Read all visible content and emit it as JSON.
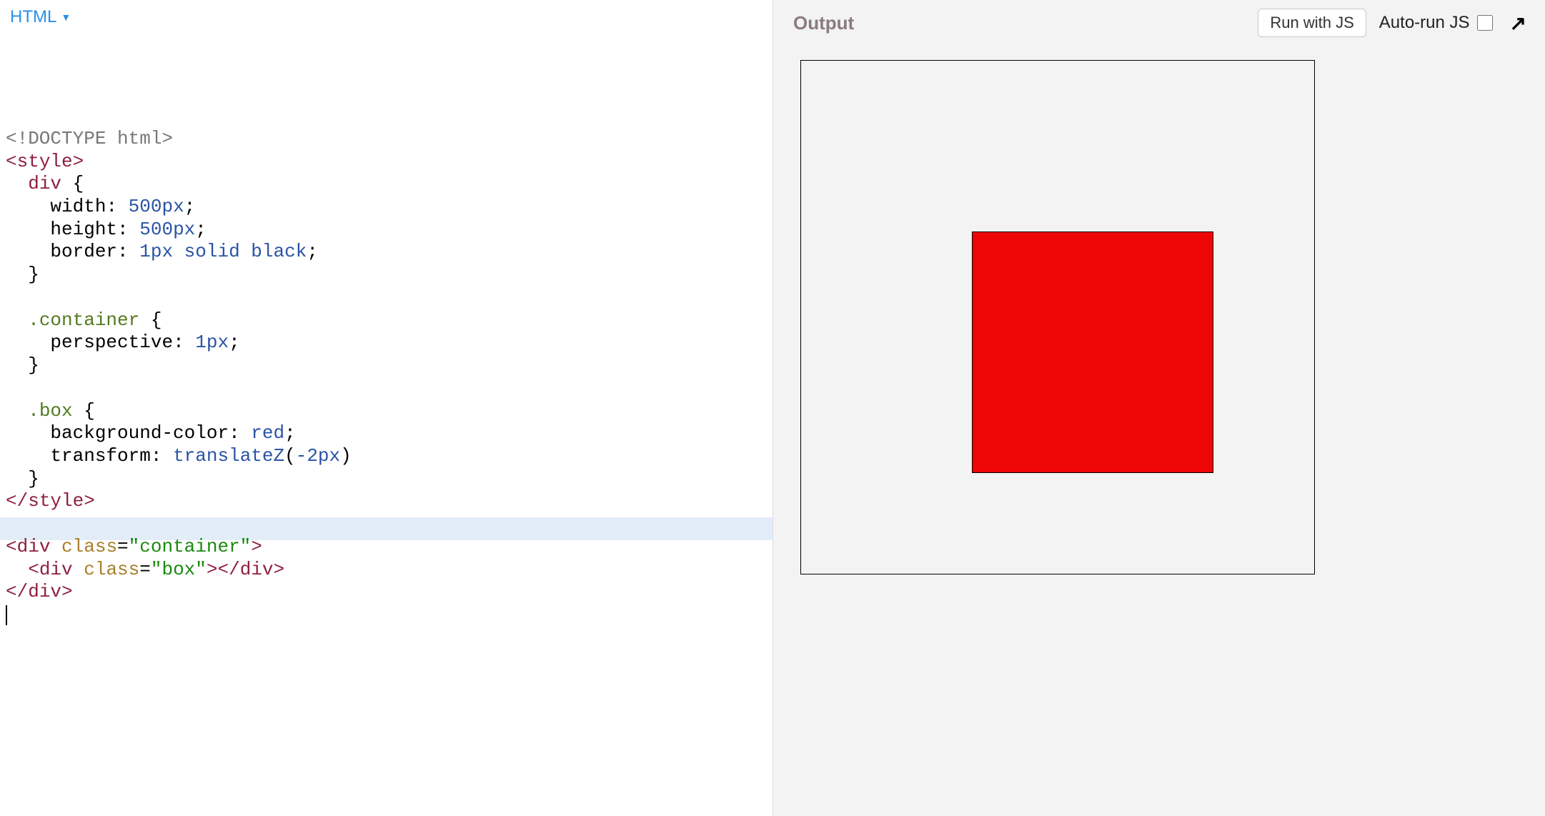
{
  "editor": {
    "tab_label": "HTML",
    "tab_caret": "▼",
    "code": {
      "line01_a": "<!DOCTYPE html>",
      "line02_open": "<",
      "line02_tag": "style",
      "line02_close": ">",
      "line03_indent": "  ",
      "line03_selector": "div",
      "line03_brace": " {",
      "line04_indent": "    ",
      "line04_prop": "width",
      "line04_colon": ": ",
      "line04_val": "500px",
      "line04_semi": ";",
      "line05_indent": "    ",
      "line05_prop": "height",
      "line05_colon": ": ",
      "line05_val": "500px",
      "line05_semi": ";",
      "line06_indent": "    ",
      "line06_prop": "border",
      "line06_colon": ": ",
      "line06_val_num": "1px",
      "line06_val_rest": " solid black",
      "line06_semi": ";",
      "line07_indent": "  ",
      "line07_brace": "}",
      "line08": "",
      "line09_indent": "  ",
      "line09_selector": ".container",
      "line09_brace": " {",
      "line10_indent": "    ",
      "line10_prop": "perspective",
      "line10_colon": ": ",
      "line10_val": "1px",
      "line10_semi": ";",
      "line11_indent": "  ",
      "line11_brace": "}",
      "line12": "",
      "line13_indent": "  ",
      "line13_selector": ".box",
      "line13_brace": " {",
      "line14_indent": "    ",
      "line14_prop": "background-color",
      "line14_colon": ": ",
      "line14_val": "red",
      "line14_semi": ";",
      "line15_indent": "    ",
      "line15_prop": "transform",
      "line15_colon": ": ",
      "line15_fn": "translateZ",
      "line15_paren_open": "(",
      "line15_arg": "-2px",
      "line15_paren_close": ")",
      "line16_indent": "  ",
      "line16_brace": "}",
      "line17_open": "</",
      "line17_tag": "style",
      "line17_close": ">",
      "line18": "",
      "line19_open": "<",
      "line19_tag": "div",
      "line19_sp": " ",
      "line19_attr": "class",
      "line19_eq": "=",
      "line19_str": "\"container\"",
      "line19_close": ">",
      "line20_indent": "  ",
      "line20_open": "<",
      "line20_tag": "div",
      "line20_sp": " ",
      "line20_attr": "class",
      "line20_eq": "=",
      "line20_str": "\"box\"",
      "line20_close": ">",
      "line20_open2": "</",
      "line20_tag2": "div",
      "line20_close2": ">",
      "line21_open": "</",
      "line21_tag": "div",
      "line21_close": ">"
    }
  },
  "output": {
    "label": "Output",
    "run_button": "Run with JS",
    "autorun_label": "Auto-run JS",
    "autorun_checked": false,
    "expand_glyph": "↗"
  }
}
